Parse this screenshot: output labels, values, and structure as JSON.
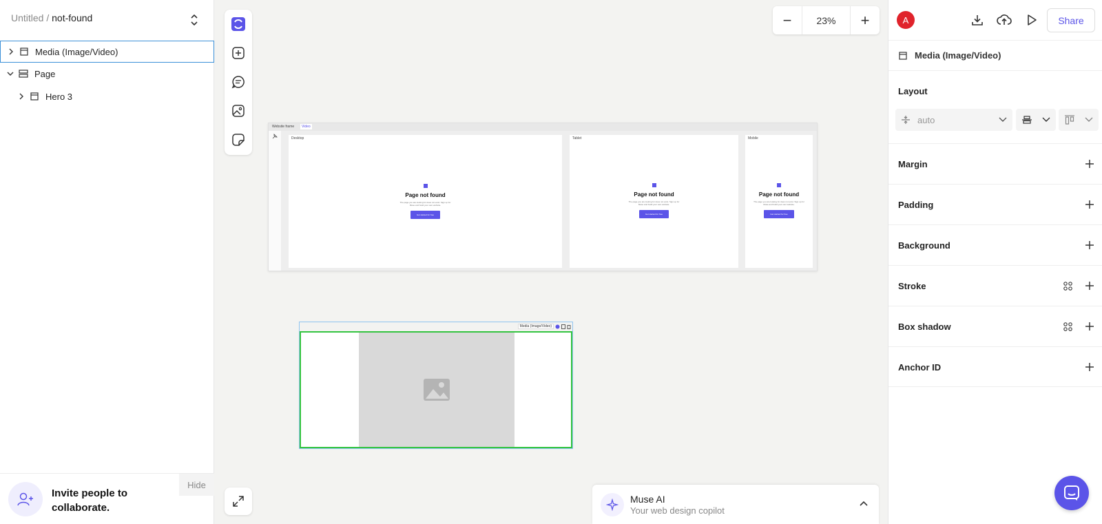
{
  "breadcrumb": {
    "project": "Untitled",
    "separator": "/",
    "page": "not-found"
  },
  "layers": [
    {
      "label": "Media (Image/Video)"
    },
    {
      "label": "Page"
    },
    {
      "label": "Hero 3"
    }
  ],
  "invite": {
    "text": "Invite people to collaborate.",
    "hide_label": "Hide"
  },
  "zoom": {
    "minus": "−",
    "value": "23%",
    "plus": "+"
  },
  "website_frame": {
    "title": "Website frame",
    "badge": "Video",
    "screens": [
      {
        "label": "Desktop",
        "heading": "Page not found",
        "subtext": "The page you are looking for does not exist. Sign up for Muse and build your own website.",
        "button": "Get started for free"
      },
      {
        "label": "Tablet",
        "heading": "Page not found",
        "subtext": "The page you are looking for does not exist. Sign up for Muse and build your own website.",
        "button": "Get started for free"
      },
      {
        "label": "Mobile",
        "heading": "Page not found",
        "subtext": "The page you are looking for does not exist. Sign up for Muse and build your own website.",
        "button": "Get started for free"
      }
    ]
  },
  "media_block": {
    "tag": "Media (Image/Video)"
  },
  "muse": {
    "title": "Muse AI",
    "subtitle": "Your web design copilot"
  },
  "right_panel": {
    "avatar": "A",
    "share": "Share",
    "selected": "Media (Image/Video)",
    "layout_heading": "Layout",
    "layout_value": "auto",
    "sections": [
      "Margin",
      "Padding",
      "Background",
      "Stroke",
      "Box shadow",
      "Anchor ID"
    ]
  },
  "colors": {
    "accent": "#5b54e8",
    "selection": "#33c33f",
    "avatar": "#e0232b",
    "layer_selection": "#3a8fd8"
  }
}
